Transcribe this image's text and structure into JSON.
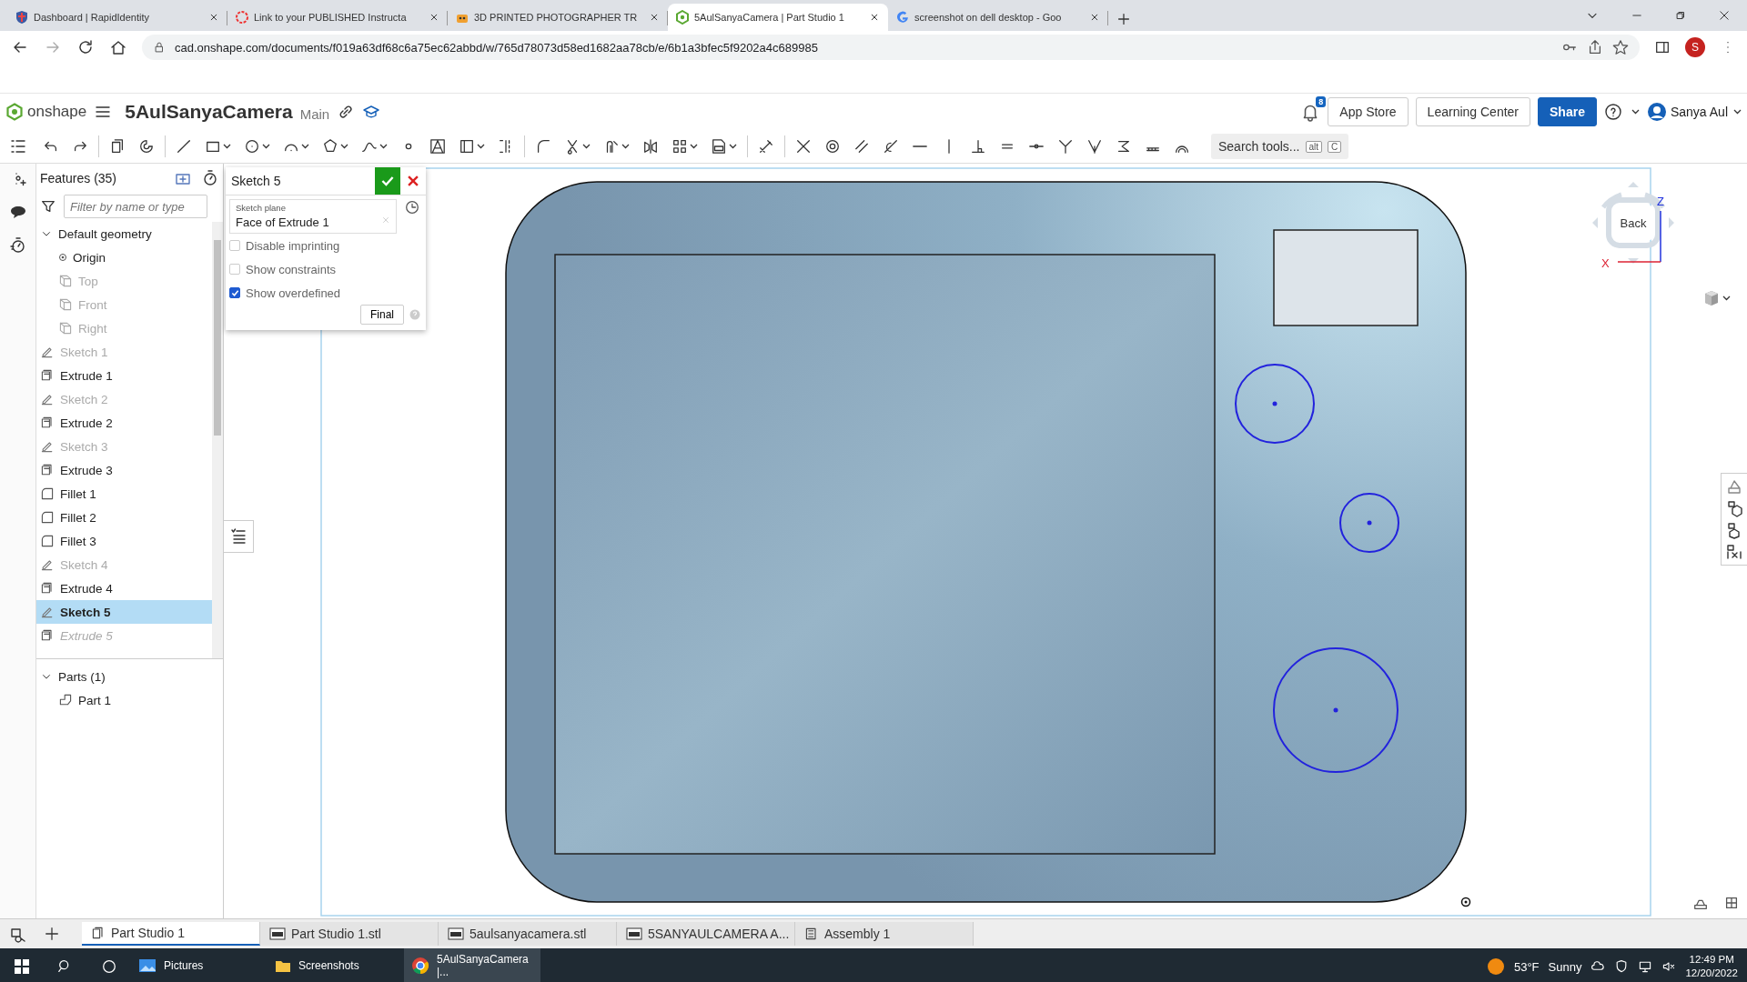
{
  "browser": {
    "tabs": [
      {
        "title": "Dashboard | RapidIdentity",
        "selected": false
      },
      {
        "title": "Link to your PUBLISHED Instructa",
        "selected": false
      },
      {
        "title": "3D PRINTED PHOTOGRAPHER TR",
        "selected": false
      },
      {
        "title": "5AulSanyaCamera | Part Studio 1",
        "selected": true
      },
      {
        "title": "screenshot on dell desktop - Goo",
        "selected": false
      }
    ],
    "url": "cad.onshape.com/documents/f019a63df68c6a75ec62abbd/w/765d78073d58ed1682aa78cb/e/6b1a3bfec5f9202a4c689985",
    "profile_initial": "S"
  },
  "header": {
    "logo_text": "onshape",
    "document_title": "5AulSanyaCamera",
    "branch": "Main",
    "notification_count": "8",
    "buttons": [
      {
        "label": "App Store",
        "primary": false
      },
      {
        "label": "Learning Center",
        "primary": false
      },
      {
        "label": "Share",
        "primary": true
      }
    ],
    "user": "Sanya Aul"
  },
  "toolbar": {
    "search_placeholder": "Search tools...",
    "shortcut": [
      "alt",
      "C"
    ]
  },
  "features": {
    "title": "Features (35)",
    "filter_placeholder": "Filter by name or type",
    "default_geometry": {
      "label": "Default geometry",
      "expanded": true,
      "children": [
        {
          "label": "Origin",
          "kind": "origin",
          "hidden": false,
          "selected": false
        },
        {
          "label": "Top",
          "kind": "plane",
          "hidden": true,
          "selected": false
        },
        {
          "label": "Front",
          "kind": "plane",
          "hidden": true,
          "selected": false
        },
        {
          "label": "Right",
          "kind": "plane",
          "hidden": true,
          "selected": false
        }
      ]
    },
    "items": [
      {
        "label": "Sketch 1",
        "kind": "sketch",
        "hidden": true,
        "rolled_back": false,
        "selected": false
      },
      {
        "label": "Extrude 1",
        "kind": "extrude",
        "hidden": false,
        "rolled_back": false,
        "selected": false
      },
      {
        "label": "Sketch 2",
        "kind": "sketch",
        "hidden": true,
        "rolled_back": false,
        "selected": false
      },
      {
        "label": "Extrude 2",
        "kind": "extrude",
        "hidden": false,
        "rolled_back": false,
        "selected": false
      },
      {
        "label": "Sketch 3",
        "kind": "sketch",
        "hidden": true,
        "rolled_back": false,
        "selected": false
      },
      {
        "label": "Extrude 3",
        "kind": "extrude",
        "hidden": false,
        "rolled_back": false,
        "selected": false
      },
      {
        "label": "Fillet 1",
        "kind": "fillet",
        "hidden": false,
        "rolled_back": false,
        "selected": false
      },
      {
        "label": "Fillet 2",
        "kind": "fillet",
        "hidden": false,
        "rolled_back": false,
        "selected": false
      },
      {
        "label": "Fillet 3",
        "kind": "fillet",
        "hidden": false,
        "rolled_back": false,
        "selected": false
      },
      {
        "label": "Sketch 4",
        "kind": "sketch",
        "hidden": true,
        "rolled_back": false,
        "selected": false
      },
      {
        "label": "Extrude 4",
        "kind": "extrude",
        "hidden": false,
        "rolled_back": false,
        "selected": false
      },
      {
        "label": "Sketch 5",
        "kind": "sketch",
        "hidden": false,
        "rolled_back": false,
        "selected": true
      },
      {
        "label": "Extrude 5",
        "kind": "extrude",
        "hidden": true,
        "rolled_back": true,
        "selected": false
      }
    ],
    "parts": {
      "label": "Parts (1)",
      "expanded": true,
      "children": [
        {
          "label": "Part 1"
        }
      ]
    }
  },
  "sketch_dialog": {
    "title": "Sketch 5",
    "plane_label": "Sketch plane",
    "plane_value": "Face of Extrude 1",
    "options": [
      {
        "label": "Disable imprinting",
        "checked": false
      },
      {
        "label": "Show constraints",
        "checked": false
      },
      {
        "label": "Show overdefined",
        "checked": true
      }
    ],
    "button": "Final"
  },
  "view_cube": {
    "face": "Back",
    "axis_up": "Z",
    "axis_side": "X"
  },
  "bottom_tabs": [
    {
      "label": "Part Studio 1",
      "kind": "partstudio",
      "selected": true
    },
    {
      "label": "Part Studio 1.stl",
      "kind": "stl",
      "selected": false
    },
    {
      "label": "5aulsanyacamera.stl",
      "kind": "stl",
      "selected": false
    },
    {
      "label": "5SANYAULCAMERA A...",
      "kind": "stl",
      "selected": false
    },
    {
      "label": "Assembly 1",
      "kind": "assembly",
      "selected": false
    }
  ],
  "taskbar": {
    "apps": [
      {
        "label": "Pictures",
        "kind": "pictures",
        "selected": false
      },
      {
        "label": "Screenshots",
        "kind": "folder",
        "selected": false
      },
      {
        "label": "5AulSanyaCamera |...",
        "kind": "chrome",
        "selected": true
      }
    ],
    "temperature": "53°F",
    "weather": "Sunny",
    "time": "12:49 PM",
    "date": "12/20/2022"
  }
}
